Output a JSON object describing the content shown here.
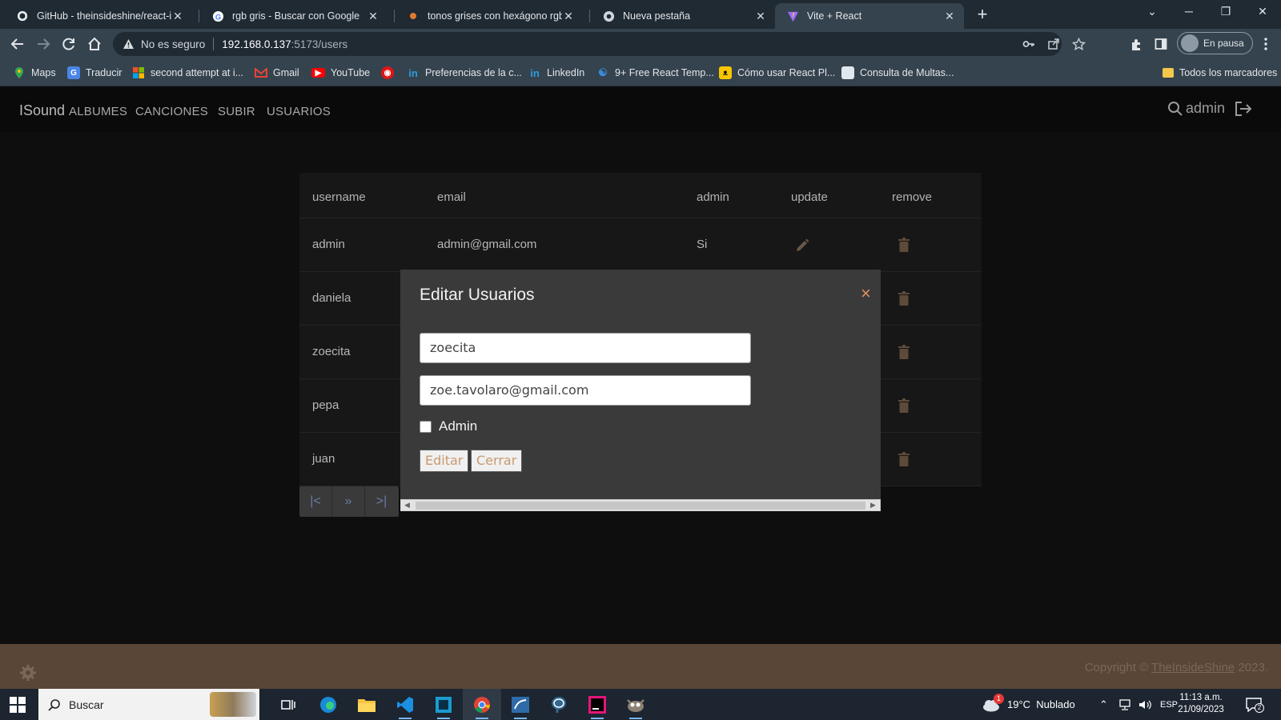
{
  "browser": {
    "tabs": [
      {
        "title": "GitHub - theinsideshine/react-ins",
        "icon": "github-icon",
        "active": false
      },
      {
        "title": "rgb gris - Buscar con Google",
        "icon": "google-icon",
        "active": false
      },
      {
        "title": "tonos grises con hexágono rgb p",
        "icon": "color-site-icon",
        "active": false
      },
      {
        "title": "Nueva pestaña",
        "icon": "chrome-icon",
        "active": false
      },
      {
        "title": "Vite + React",
        "icon": "vite-icon",
        "active": true
      }
    ],
    "new_tab_label": "+",
    "address": {
      "security_label": "No es seguro",
      "host": "192.168.0.137",
      "path": ":5173/users"
    },
    "profile_label": "En pausa",
    "bookmarks": [
      {
        "label": "Maps",
        "icon": "maps-icon"
      },
      {
        "label": "Traducir",
        "icon": "translate-icon"
      },
      {
        "label": "second attempt at i...",
        "icon": "microsoft-icon"
      },
      {
        "label": "Gmail",
        "icon": "gmail-icon"
      },
      {
        "label": "YouTube",
        "icon": "youtube-icon"
      },
      {
        "label": "",
        "icon": "red-circle-icon"
      },
      {
        "label": "Preferencias de la c...",
        "icon": "linkedin-icon"
      },
      {
        "label": "LinkedIn",
        "icon": "linkedin-icon"
      },
      {
        "label": "9+ Free React Temp...",
        "icon": "react-icon"
      },
      {
        "label": "Cómo usar React Pl...",
        "icon": "cat-icon"
      },
      {
        "label": "Consulta de Multas...",
        "icon": "document-icon"
      }
    ],
    "all_bookmarks_label": "Todos los marcadores"
  },
  "app": {
    "brand": "ISound",
    "nav": [
      "ALBUMES",
      "CANCIONES",
      "SUBIR",
      "USUARIOS"
    ],
    "current_user": "admin"
  },
  "users_table": {
    "columns": [
      "username",
      "email",
      "admin",
      "update",
      "remove"
    ],
    "rows": [
      {
        "username": "admin",
        "email": "admin@gmail.com",
        "admin": "Si"
      },
      {
        "username": "daniela"
      },
      {
        "username": "zoecita"
      },
      {
        "username": "pepa"
      },
      {
        "username": "juan"
      }
    ]
  },
  "pagination": [
    "|<",
    "»",
    ">|"
  ],
  "modal": {
    "title": "Editar Usuarios",
    "close_icon": "×",
    "username_value": "zoecita",
    "email_value": "zoe.tavolaro@gmail.com",
    "admin_label": "Admin",
    "admin_checked": false,
    "edit_button": "Editar",
    "close_button": "Cerrar"
  },
  "footer": {
    "copyright_prefix": "Copyright © ",
    "owner": "TheInsideShine",
    "year_suffix": " 2023."
  },
  "taskbar": {
    "search_label": "Buscar",
    "weather": "19°C  Nublado",
    "weather_badge": "1",
    "language": "ESP",
    "time": "11:13 a.m.",
    "date": "21/09/2023",
    "notifications_badge": "2"
  },
  "colors": {
    "page_bg": "#0e0e0e",
    "card_bg": "#171717",
    "modal_bg": "#3a3a3a",
    "footer_bg": "#5a4636",
    "accent": "#c79b70",
    "trash": "#5e4a3a"
  }
}
